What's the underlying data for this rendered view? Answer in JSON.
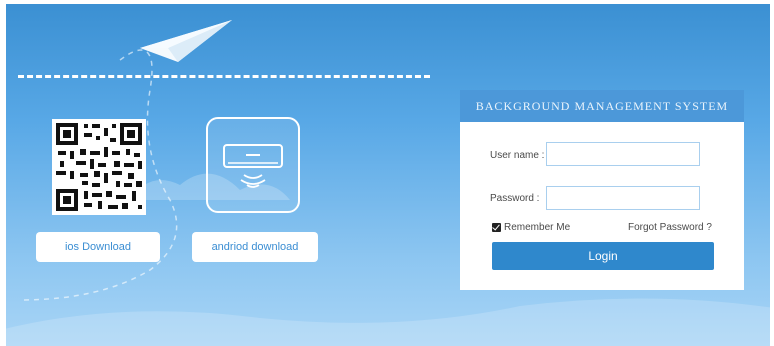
{
  "downloads": {
    "ios_label": "ios Download",
    "android_label": "andriod download"
  },
  "login": {
    "title": "BACKGROUND MANAGEMENT SYSTEM",
    "username_label": "User name :",
    "username_value": "",
    "password_label": "Password :",
    "password_value": "",
    "remember_label": "Remember Me",
    "remember_checked": true,
    "forgot_label": "Forgot Password ?",
    "login_button": "Login"
  },
  "icons": {
    "plane": "paper-plane-icon",
    "qr": "qr-code-icon",
    "app": "air-conditioner-icon"
  },
  "colors": {
    "background_top": "#3a8fd2",
    "background_bottom": "#a9d5f6",
    "panel_header": "#4c98d9",
    "login_button": "#2f88cc",
    "download_text": "#3b8ed3"
  }
}
